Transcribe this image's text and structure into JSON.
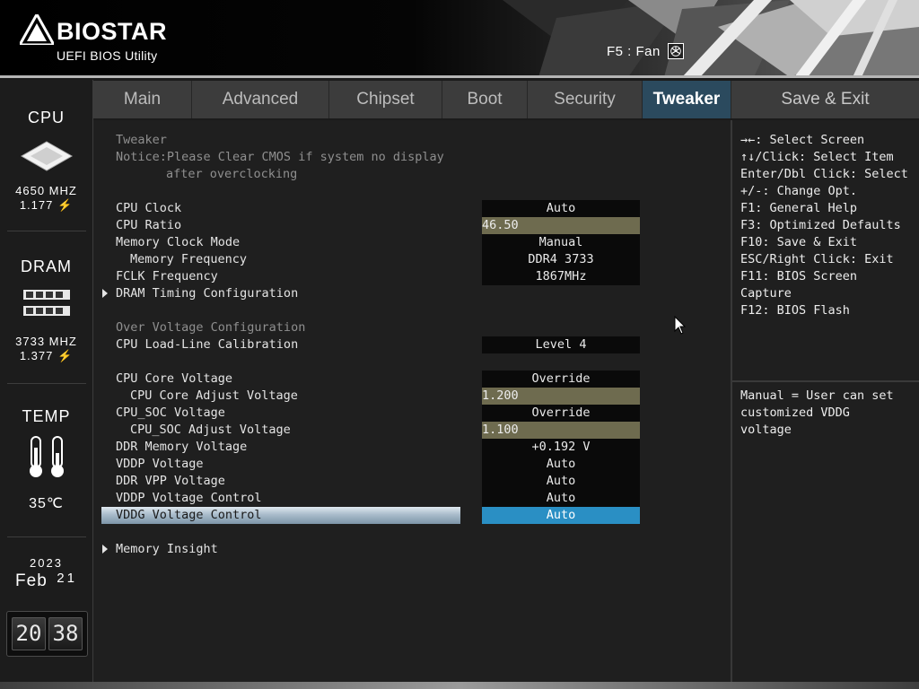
{
  "header": {
    "brand": "BIOSTAR",
    "subtitle": "UEFI BIOS Utility",
    "fan_hint": "F5 : Fan",
    "fan_icon": "fan-icon"
  },
  "sidebar": {
    "cpu": {
      "title": "CPU",
      "freq": "4650 MHZ",
      "volt": "1.177 ⚡"
    },
    "dram": {
      "title": "DRAM",
      "freq": "3733 MHZ",
      "volt": "1.377 ⚡"
    },
    "temp": {
      "title": "TEMP",
      "value": "35℃"
    },
    "date": {
      "year": "2023",
      "month": "Feb",
      "day": "21"
    },
    "clock": {
      "hours": "20",
      "minutes": "38"
    }
  },
  "tabs": [
    "Main",
    "Advanced",
    "Chipset",
    "Boot",
    "Security",
    "Tweaker",
    "Save & Exit"
  ],
  "active_tab": "Tweaker",
  "main": {
    "section_title": "Tweaker",
    "notice_1": "Notice:Please Clear CMOS if system no display",
    "notice_2": "after overclocking",
    "cpu_clock": {
      "label": "CPU Clock",
      "value": "Auto"
    },
    "cpu_ratio": {
      "label": "CPU Ratio",
      "value": "46.50"
    },
    "mem_clock_mode": {
      "label": "Memory Clock Mode",
      "value": "Manual"
    },
    "mem_freq": {
      "label": "Memory Frequency",
      "value": "DDR4 3733"
    },
    "fclk": {
      "label": "FCLK Frequency",
      "value": "1867MHz"
    },
    "dram_timing": {
      "label": "DRAM Timing Configuration"
    },
    "ov_title": "Over Voltage Configuration",
    "llc": {
      "label": "CPU Load-Line Calibration",
      "value": "Level 4"
    },
    "core_v": {
      "label": "CPU Core Voltage",
      "value": "Override"
    },
    "core_adj": {
      "label": "CPU Core Adjust Voltage",
      "value": "1.200"
    },
    "soc_v": {
      "label": "CPU_SOC Voltage",
      "value": "Override"
    },
    "soc_adj": {
      "label": "CPU_SOC Adjust Voltage",
      "value": "1.100"
    },
    "ddr_v": {
      "label": "DDR Memory Voltage",
      "value": "+0.192 V"
    },
    "vddp": {
      "label": "VDDP Voltage",
      "value": "Auto"
    },
    "ddr_vpp": {
      "label": "DDR VPP Voltage",
      "value": "Auto"
    },
    "vddp_ctrl": {
      "label": "VDDP Voltage Control",
      "value": "Auto"
    },
    "vddg_ctrl": {
      "label": "VDDG Voltage Control",
      "value": "Auto"
    },
    "mem_insight": {
      "label": "Memory Insight"
    }
  },
  "help": {
    "keys": [
      "→←: Select Screen",
      "↑↓/Click: Select Item",
      "Enter/Dbl Click: Select",
      "+/-: Change Opt.",
      "F1: General Help",
      "F3: Optimized Defaults",
      "F10: Save & Exit",
      "ESC/Right Click: Exit",
      "F11: BIOS Screen",
      "Capture",
      "F12: BIOS Flash"
    ],
    "description": [
      "Manual = User can set",
      "customized VDDG",
      "voltage"
    ]
  }
}
